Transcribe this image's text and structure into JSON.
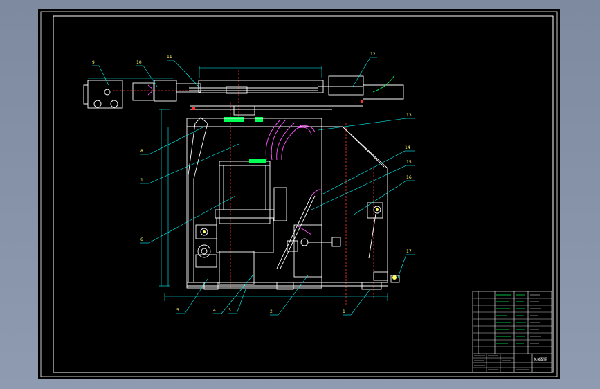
{
  "drawing": {
    "title_block": {
      "title": "总装配图"
    },
    "callouts": [
      {
        "id": "c9",
        "label": "9"
      },
      {
        "id": "c10",
        "label": "10"
      },
      {
        "id": "c11",
        "label": "11"
      },
      {
        "id": "c12",
        "label": "12"
      },
      {
        "id": "c13",
        "label": "13"
      },
      {
        "id": "c14",
        "label": "14"
      },
      {
        "id": "c15",
        "label": "15"
      },
      {
        "id": "c16",
        "label": "16"
      },
      {
        "id": "c17",
        "label": "17"
      },
      {
        "id": "c8",
        "label": "8"
      },
      {
        "id": "c1",
        "label": "1"
      },
      {
        "id": "c6",
        "label": "6"
      },
      {
        "id": "c5",
        "label": "5"
      },
      {
        "id": "c4",
        "label": "4"
      },
      {
        "id": "c3",
        "label": "3"
      },
      {
        "id": "c2",
        "label": "2"
      },
      {
        "id": "c1b",
        "label": "1"
      }
    ],
    "colors": {
      "frame": "#ffffff",
      "outline": "#ffffff",
      "hidden": "#ff3030",
      "leader": "#00ffff",
      "dimension": "#00ffff",
      "callout_text": "#ffff66",
      "green": "#00ff55",
      "magenta": "#ff55ff",
      "background": "#000000"
    }
  }
}
